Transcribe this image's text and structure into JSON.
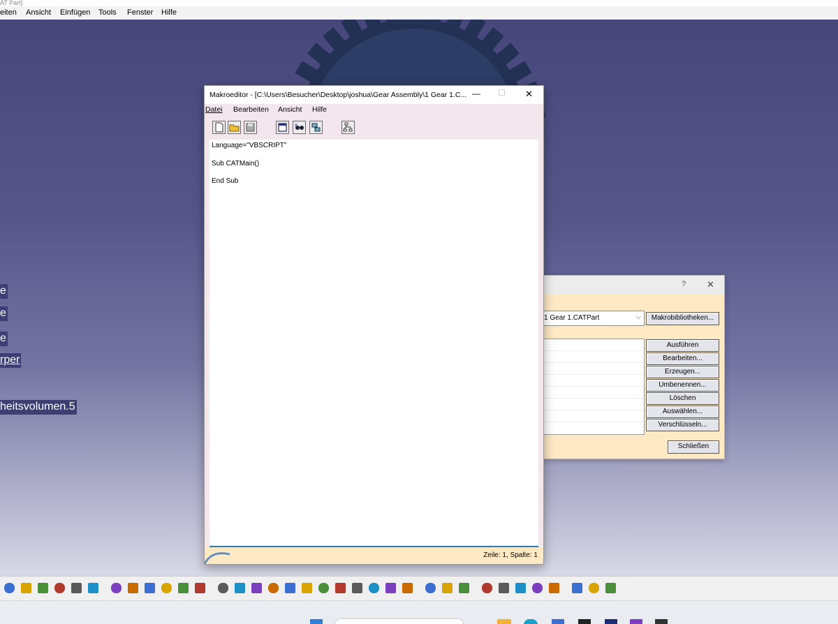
{
  "app": {
    "title_fragment": "AT Part]",
    "menu": [
      "eiten",
      "Ansicht",
      "Einfügen",
      "Tools",
      "Fenster",
      "Hilfe"
    ]
  },
  "tree_labels": [
    "e",
    "e",
    "e",
    "rper",
    "heitsvolumen.5"
  ],
  "macro_dialog": {
    "help_icon": "?",
    "close_icon": "✕",
    "library_value": "1 Gear  1.CATPart",
    "library_button": "Makrobibliotheken...",
    "buttons": [
      "Ausführen",
      "Bearbeiten...",
      "Erzeugen...",
      "Umbenennen...",
      "Löschen",
      "Auswählen...",
      "Verschlüsseln..."
    ],
    "close_button": "Schließen"
  },
  "editor": {
    "title": "Makroeditor - [C:\\Users\\Besucher\\Desktop\\joshua\\Gear Assembly\\1 Gear  1.C...",
    "minimize_glyph": "—",
    "maximize_glyph": "☐",
    "close_glyph": "✕",
    "menu": [
      "Datei",
      "Bearbeiten",
      "Ansicht",
      "Hilfe"
    ],
    "code_lines": [
      "Language=\"VBSCRIPT\"",
      "Sub CATMain()",
      "End Sub"
    ],
    "status": "Zeile: 1, Spalte: 1"
  },
  "toolbar_icons": [
    "cut-icon",
    "copy-icon",
    "paste-icon",
    "undo-icon",
    "redo-icon",
    "whats-this-icon",
    "formula-icon",
    "comment-icon",
    "sensor-icon",
    "table-icon",
    "measure-icon",
    "parameter-icon",
    "fit-all-icon",
    "zoom-area-icon",
    "pan-icon",
    "rotate-icon",
    "zoom-in-icon",
    "zoom-out-icon",
    "normal-view-icon",
    "view-icon",
    "isometric-icon",
    "render-style-icon",
    "hide-show-icon",
    "swap-icon",
    "snapshot-icon",
    "update-icon",
    "manipulate-icon",
    "constraint-icon",
    "compass-icon",
    "axis-icon",
    "scale-icon",
    "analysis-icon",
    "apply-material-icon",
    "paint-icon",
    "knowledge-icon"
  ],
  "colors": {
    "viewport_top": "#47477b",
    "viewport_bottom": "#d8d8e6",
    "editor_bg": "#f3e7ed",
    "dialog_bg": "#fde9c4",
    "selection_blue": "#2a7ab8"
  }
}
